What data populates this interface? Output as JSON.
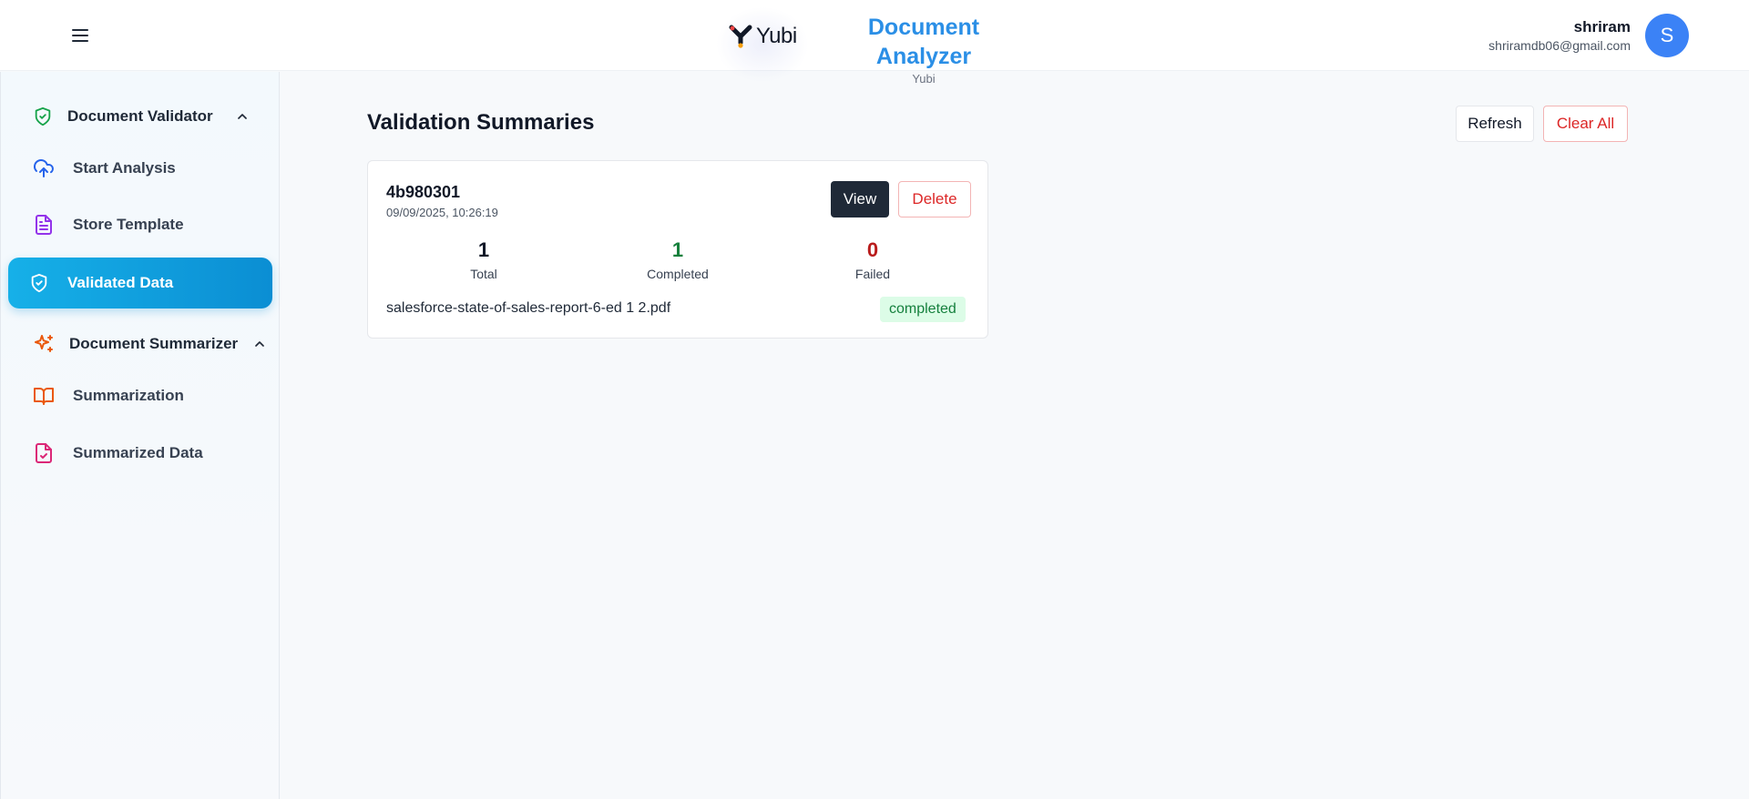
{
  "header": {
    "menu_icon": "hamburger-menu-icon",
    "logo_text": "Yubi",
    "title": "Document Analyzer",
    "subtitle": "Yubi",
    "user": {
      "name": "shriram",
      "email": "shriramdb06@gmail.com",
      "avatar_initial": "S",
      "avatar_color": "#3b82f6"
    }
  },
  "sidebar": {
    "groups": [
      {
        "label": "Document Validator",
        "icon": "shield-check-icon",
        "expanded": true,
        "items": [
          {
            "label": "Start Analysis",
            "icon": "cloud-upload-icon",
            "active": false
          },
          {
            "label": "Store Template",
            "icon": "file-text-icon",
            "active": false
          },
          {
            "label": "Validated Data",
            "icon": "shield-check-icon",
            "active": true
          }
        ]
      },
      {
        "label": "Document Summarizer",
        "icon": "sparkles-icon",
        "expanded": true,
        "items": [
          {
            "label": "Summarization",
            "icon": "book-open-icon",
            "active": false
          },
          {
            "label": "Summarized Data",
            "icon": "file-check-icon",
            "active": false
          }
        ]
      }
    ],
    "active_color": "#0b8ed3"
  },
  "main": {
    "title": "Validation Summaries",
    "refresh_label": "Refresh",
    "clear_all_label": "Clear All",
    "summaries": [
      {
        "id": "4b980301",
        "timestamp": "09/09/2025, 10:26:19",
        "view_label": "View",
        "delete_label": "Delete",
        "stats": {
          "total": {
            "value": "1",
            "label": "Total"
          },
          "completed": {
            "value": "1",
            "label": "Completed"
          },
          "failed": {
            "value": "0",
            "label": "Failed"
          }
        },
        "file_name": "salesforce-state-of-sales-report-6-ed 1 2.pdf",
        "status": "completed"
      }
    ]
  }
}
